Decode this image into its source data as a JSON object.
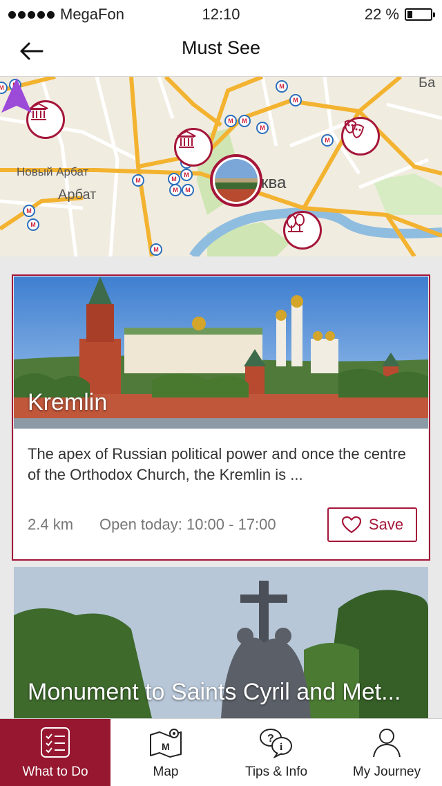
{
  "status_bar": {
    "carrier": "MegaFon",
    "time": "12:10",
    "battery_percent": "22 %",
    "battery_level": 0.22
  },
  "header": {
    "title": "Must See"
  },
  "map": {
    "labels": {
      "novy_arbat": "Новый Арбат",
      "arbat": "Арбат",
      "moskva": "ква",
      "corner": "Ба"
    }
  },
  "cards": [
    {
      "title": "Kremlin",
      "description": "The apex of Russian political power and once the centre of the Orthodox Church, the Kremlin is ...",
      "distance": "2.4 km",
      "hours": "Open today: 10:00 - 17:00",
      "save_label": "Save"
    },
    {
      "title": "Monument to Saints Cyril and Met..."
    }
  ],
  "tabs": [
    {
      "label": "What to Do",
      "icon": "checklist-icon",
      "active": true
    },
    {
      "label": "Map",
      "icon": "map-icon",
      "active": false
    },
    {
      "label": "Tips & Info",
      "icon": "tips-info-icon",
      "active": false
    },
    {
      "label": "My Journey",
      "icon": "person-icon",
      "active": false
    }
  ],
  "colors": {
    "accent": "#a5163a",
    "tab_active": "#96172f",
    "nav_arrow": "#9b4bd8"
  }
}
